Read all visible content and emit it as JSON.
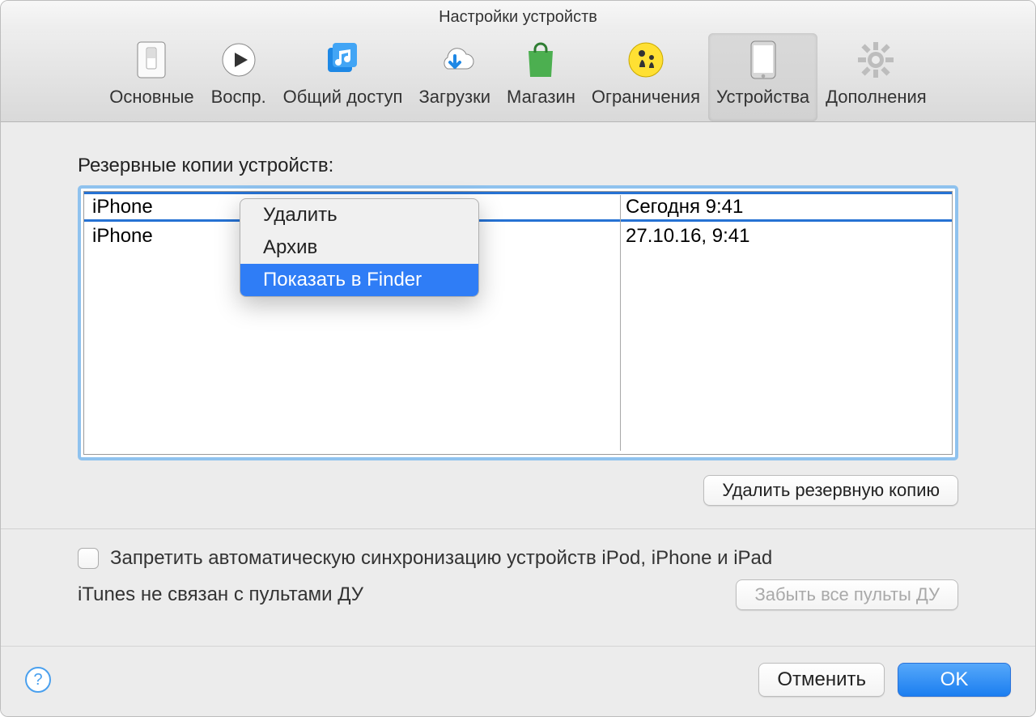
{
  "window": {
    "title": "Настройки устройств"
  },
  "toolbar": {
    "tabs": [
      {
        "id": "general",
        "label": "Основные"
      },
      {
        "id": "playback",
        "label": "Воспр."
      },
      {
        "id": "sharing",
        "label": "Общий доступ"
      },
      {
        "id": "downloads",
        "label": "Загрузки"
      },
      {
        "id": "store",
        "label": "Магазин"
      },
      {
        "id": "restrictions",
        "label": "Ограничения"
      },
      {
        "id": "devices",
        "label": "Устройства"
      },
      {
        "id": "advanced",
        "label": "Дополнения"
      }
    ],
    "selected": "devices"
  },
  "backups": {
    "heading": "Резервные копии устройств:",
    "rows": [
      {
        "device": "iPhone",
        "date": "Сегодня 9:41",
        "selected": true
      },
      {
        "device": "iPhone",
        "date": "27.10.16, 9:41",
        "selected": false
      }
    ],
    "delete_button": "Удалить резервную копию"
  },
  "context_menu": {
    "items": [
      {
        "label": "Удалить",
        "highlighted": false
      },
      {
        "label": "Архив",
        "highlighted": false
      },
      {
        "label": "Показать в Finder",
        "highlighted": true
      }
    ]
  },
  "sync": {
    "checkbox_label": "Запретить автоматическую синхронизацию устройств iPod, iPhone и iPad",
    "checked": false
  },
  "remote": {
    "status": "iTunes не связан с пультами ДУ",
    "forget_button": "Забыть все пульты ДУ",
    "forget_enabled": false
  },
  "footer": {
    "cancel": "Отменить",
    "ok": "OK"
  }
}
